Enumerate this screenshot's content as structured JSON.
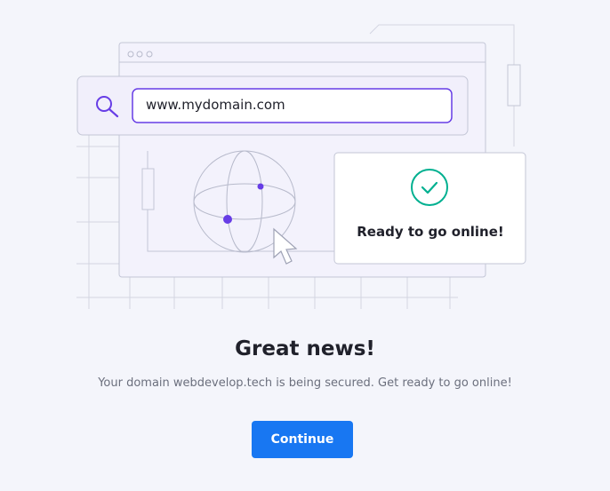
{
  "illustration": {
    "url": "www.mydomain.com",
    "status_card_label": "Ready to go online!"
  },
  "main": {
    "heading": "Great news!",
    "subtext": "Your domain webdevelop.tech is being secured. Get ready to go online!",
    "continue_label": "Continue"
  },
  "colors": {
    "accent_purple": "#673de6",
    "check_green": "#00b090",
    "button_blue": "#1877f2"
  }
}
